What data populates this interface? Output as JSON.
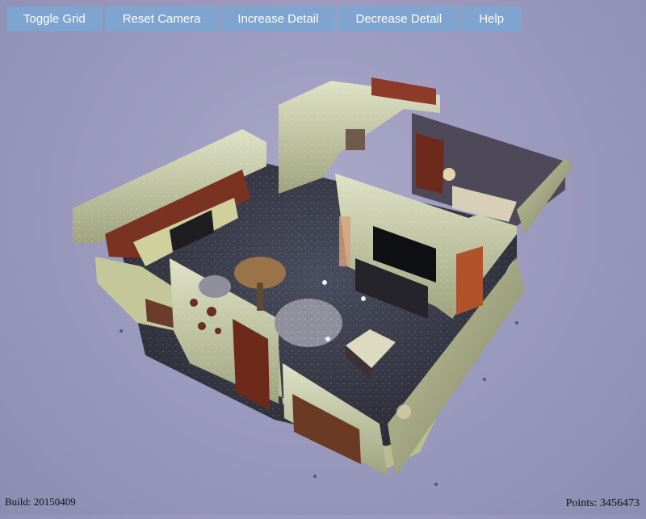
{
  "toolbar": {
    "buttons": [
      {
        "label": "Toggle Grid"
      },
      {
        "label": "Reset Camera"
      },
      {
        "label": "Increase Detail"
      },
      {
        "label": "Decrease Detail"
      },
      {
        "label": "Help"
      }
    ]
  },
  "status": {
    "build": "Build: 20150409",
    "points": "Points: 3456473"
  },
  "colors": {
    "button_bg": "#7fa4cf",
    "background": "#9c9bbf",
    "wall": "#c9cfae"
  }
}
